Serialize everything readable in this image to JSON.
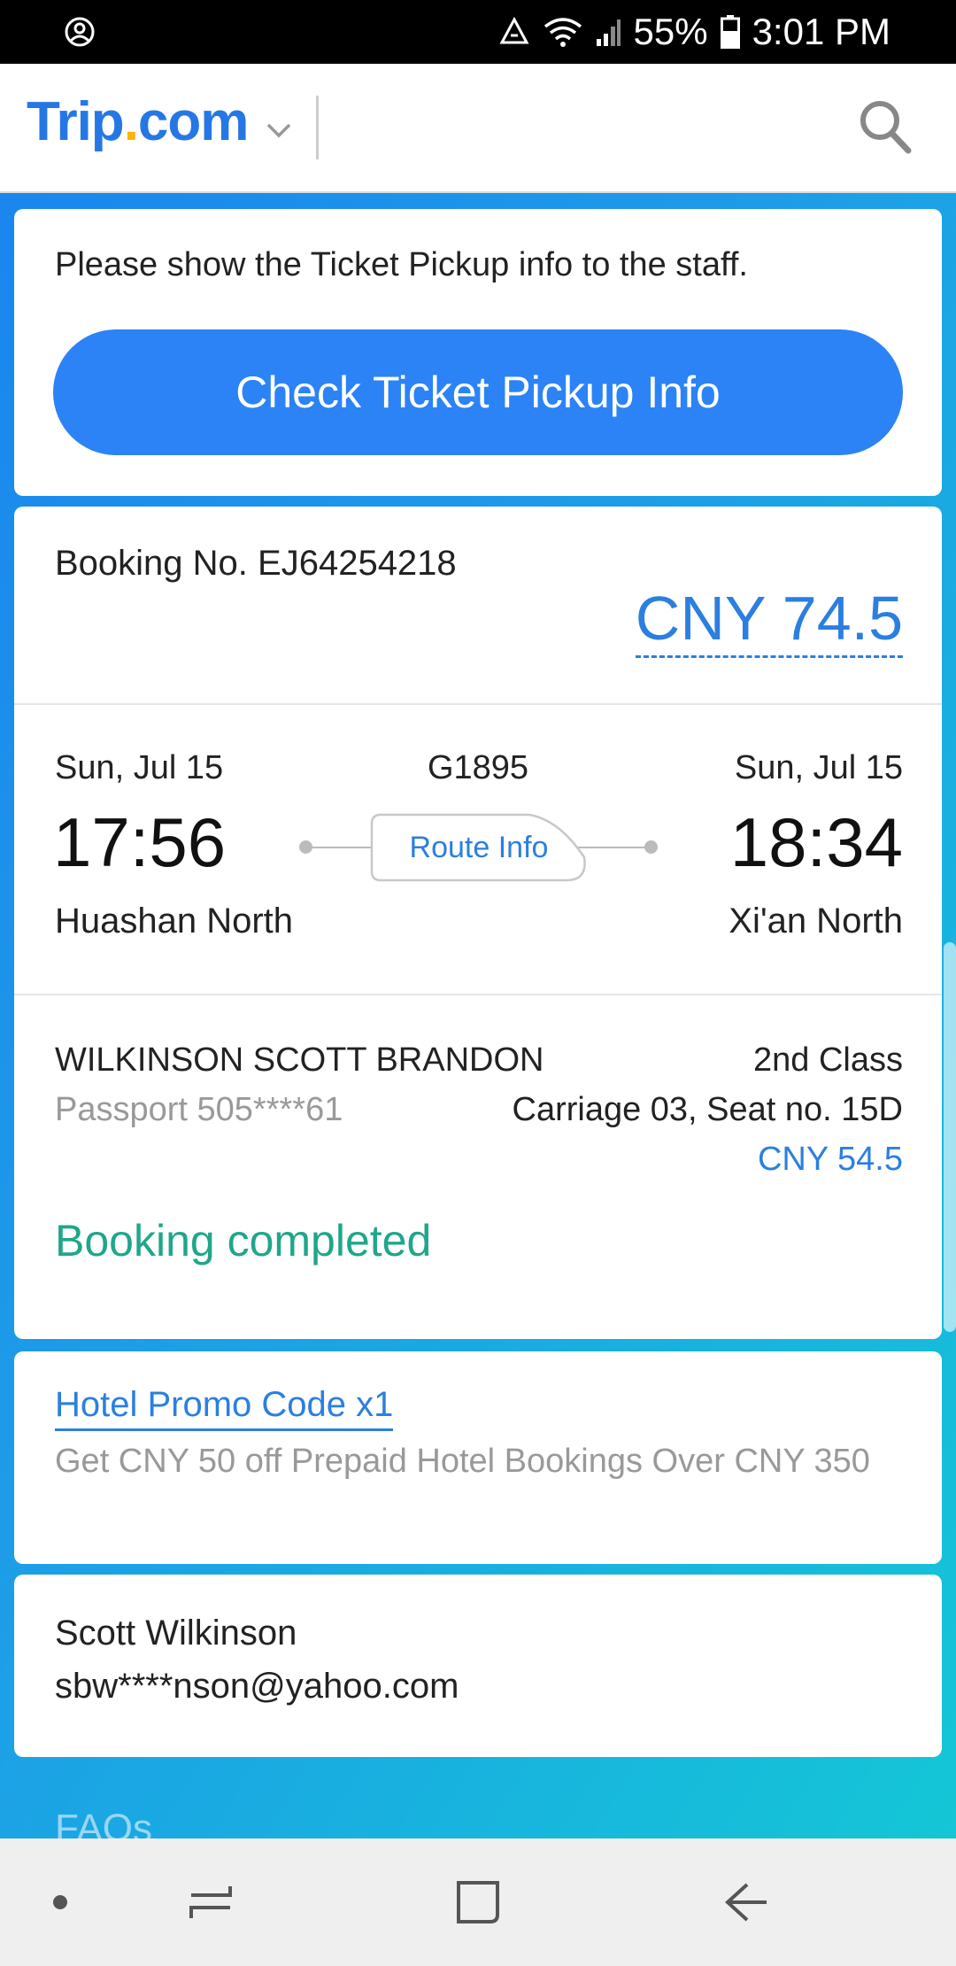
{
  "status_bar": {
    "battery": "55%",
    "time": "3:01 PM",
    "icons": [
      "account-circle-icon",
      "recycle-icon",
      "wifi-icon",
      "signal-icon",
      "battery-icon"
    ]
  },
  "header": {
    "logo_part1": "Trip",
    "logo_dot": ".",
    "logo_part2": "com",
    "colors": {
      "brand": "#2677e6",
      "dot": "#ffb300"
    }
  },
  "pickup_card": {
    "message": "Please show the Ticket Pickup info to the staff.",
    "button_label": "Check Ticket Pickup Info"
  },
  "booking": {
    "booking_no": "Booking No. EJ64254218",
    "total_price": "CNY 74.5",
    "train": {
      "departure_date": "Sun, Jul 15",
      "departure_time": "17:56",
      "departure_station": "Huashan North",
      "train_number": "G1895",
      "route_label": "Route Info",
      "arrival_date": "Sun, Jul 15",
      "arrival_time": "18:34",
      "arrival_station": "Xi'an North"
    },
    "passenger": {
      "name": "WILKINSON SCOTT BRANDON",
      "passport": "Passport 505****61",
      "class": "2nd Class",
      "seat": "Carriage 03, Seat no. 15D",
      "price": "CNY 54.5"
    },
    "status": "Booking completed",
    "colors": {
      "accent": "#2b7fe0",
      "status": "#20a68a",
      "button": "#2b83f6"
    }
  },
  "promo": {
    "link_label": "Hotel Promo Code x1",
    "description": "Get CNY 50 off Prepaid Hotel Bookings Over CNY 350"
  },
  "contact": {
    "name": "Scott Wilkinson",
    "email": "sbw****nson@yahoo.com"
  },
  "faqs_label": "FAQs",
  "nav_bar": {
    "buttons": [
      "dot-icon",
      "recent-apps-icon",
      "home-icon",
      "back-icon"
    ]
  }
}
